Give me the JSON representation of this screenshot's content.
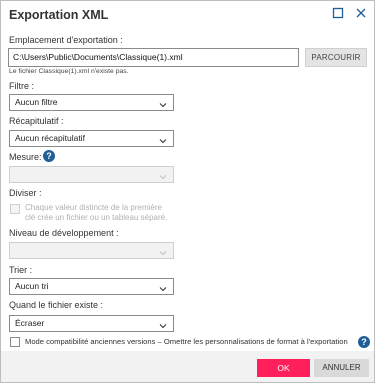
{
  "dialog": {
    "title": "Exportation XML",
    "minimize_icon": "square-icon",
    "close_icon": "close-icon"
  },
  "location": {
    "label": "Emplacement d'exportation :",
    "path": "C:\\Users\\Public\\Documents\\Classique(1).xml",
    "browse_label": "PARCOURIR",
    "note": "Le fichier Classique(1).xml n'existe pas."
  },
  "filter": {
    "label": "Filtre :",
    "value": "Aucun filtre"
  },
  "summary": {
    "label": "Récapitulatif :",
    "value": "Aucun récapitulatif"
  },
  "measure": {
    "label": "Mesure:",
    "value": ""
  },
  "split": {
    "label": "Diviser :",
    "checkbox_line1": "Chaque valeur distincte de la première",
    "checkbox_line2": "clé crée un fichier ou un tableau séparé."
  },
  "level": {
    "label": "Niveau de développement :",
    "value": ""
  },
  "sort": {
    "label": "Trier :",
    "value": "Aucun tri"
  },
  "exists": {
    "label": "Quand le fichier existe :",
    "value": "Écraser"
  },
  "compat": {
    "label": "Mode compatibilité anciennes versions – Omettre les personnalisations de format à l'exportation"
  },
  "footer": {
    "ok_label": "OK",
    "cancel_label": "ANNULER"
  },
  "colors": {
    "accent": "#ff1f5a",
    "help": "#1f5f99"
  }
}
